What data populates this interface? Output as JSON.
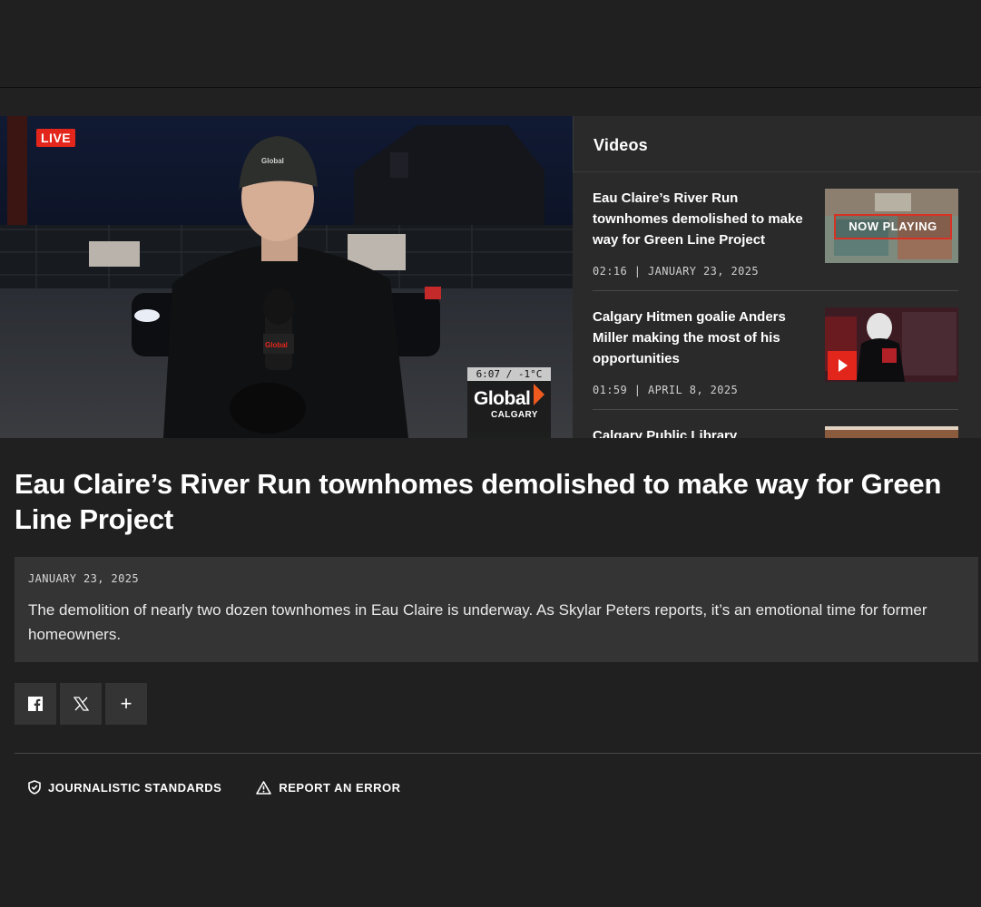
{
  "player": {
    "live_label": "LIVE",
    "bug_time": "6:07 / -1°C",
    "bug_brand": "Global",
    "bug_station": "CALGARY"
  },
  "sidebar": {
    "title": "Videos",
    "items": [
      {
        "title": "Eau Claire’s River Run townhomes demolished to make way for Green Line Project",
        "meta": "02:16 | JANUARY 23, 2025",
        "overlay": "NOW PLAYING"
      },
      {
        "title": "Calgary Hitmen goalie Anders Miller making the most of his opportunities",
        "meta": "01:59 | APRIL 8, 2025"
      },
      {
        "title": "Calgary Public Library Foundation",
        "meta": ""
      }
    ]
  },
  "article": {
    "headline": "Eau Claire’s River Run townhomes demolished to make way for Green Line Project",
    "date": "JANUARY 23, 2025",
    "description": "The demolition of nearly two dozen townhomes in Eau Claire is underway. As Skylar Peters reports, it’s an emotional time for former homeowners."
  },
  "share": {
    "facebook": "f",
    "x": "𝕏",
    "more": "+"
  },
  "footer": {
    "standards": "JOURNALISTIC STANDARDS",
    "report": "REPORT AN ERROR"
  },
  "colors": {
    "background": "#212020",
    "panel": "#353434",
    "accent_red": "#e3261c"
  }
}
